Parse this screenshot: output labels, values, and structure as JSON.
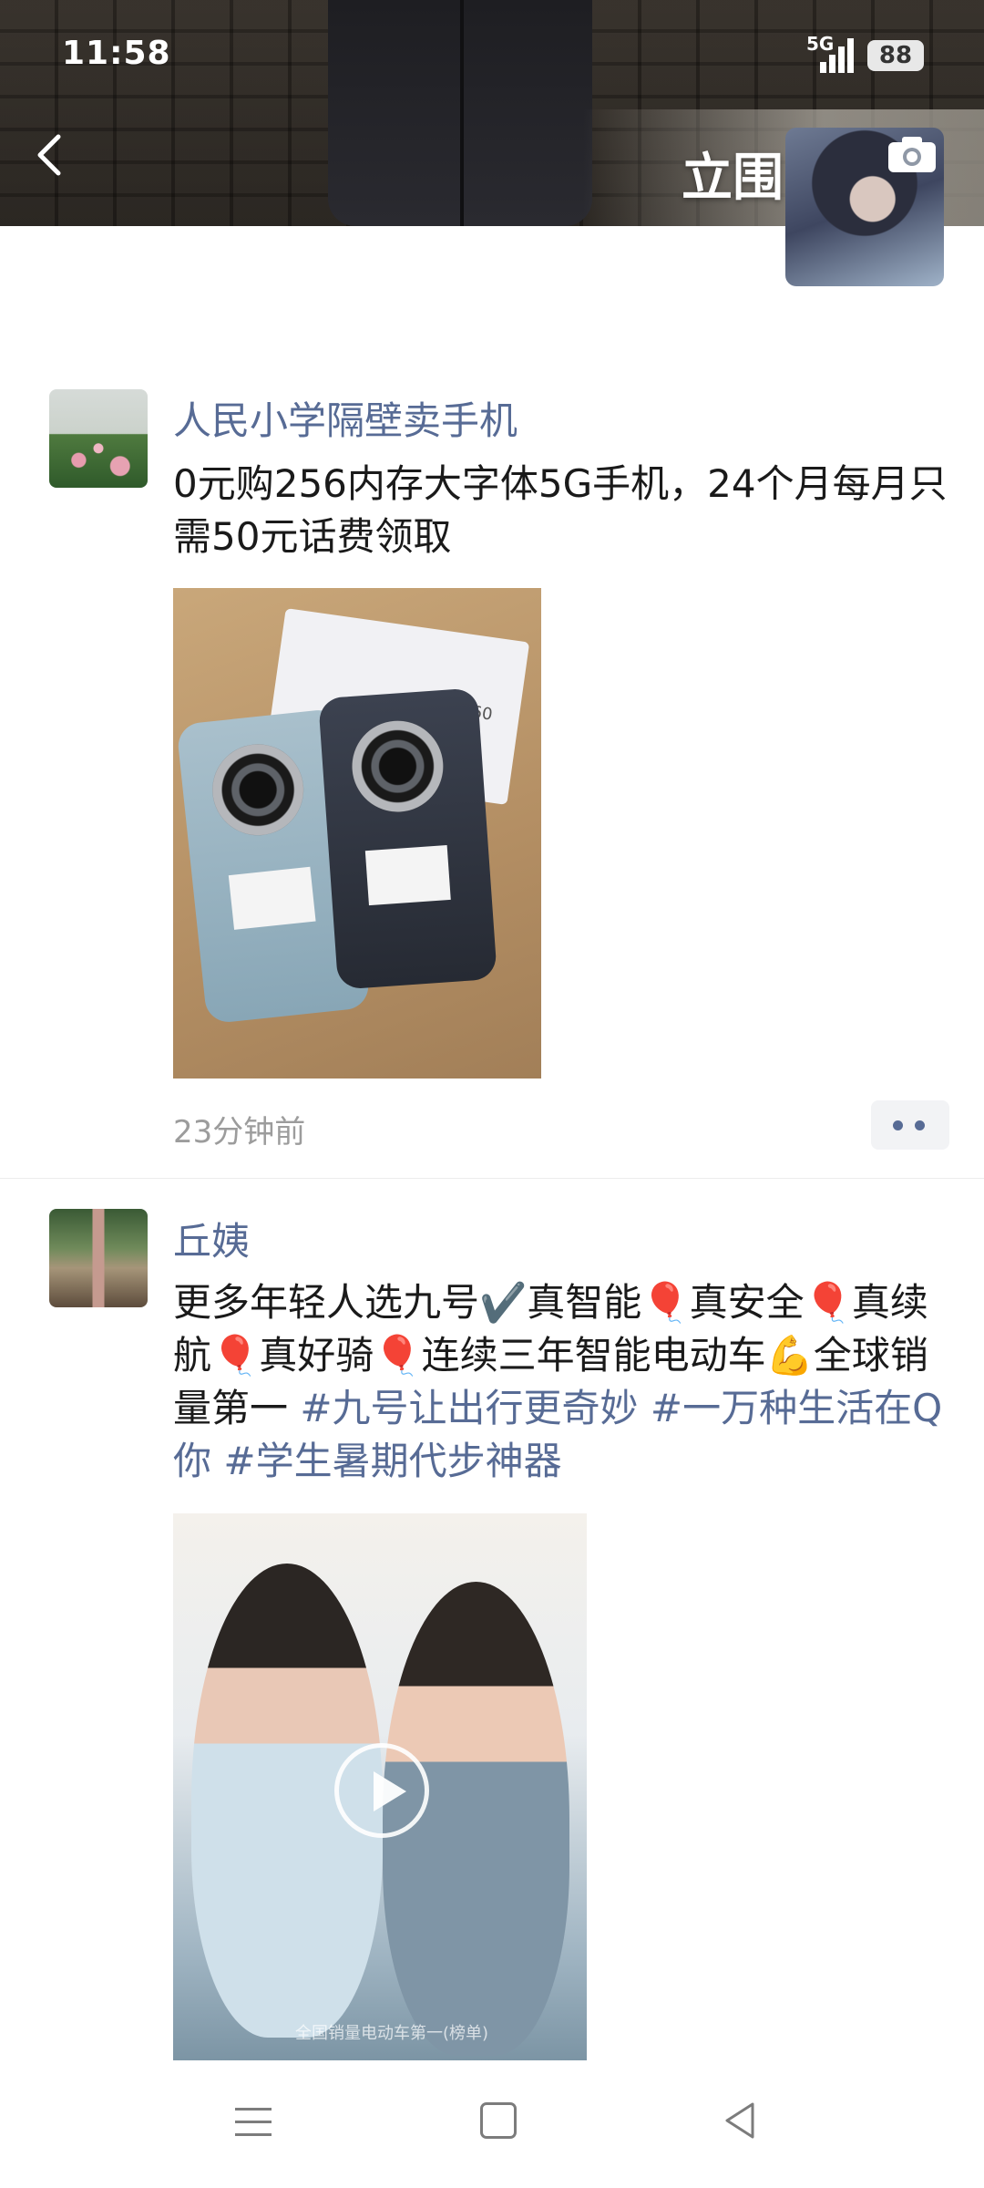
{
  "status_bar": {
    "time": "11:58",
    "network": "5G",
    "battery": "88"
  },
  "profile": {
    "name": "立围",
    "back_icon": "chevron-left-icon",
    "camera_icon": "camera-icon"
  },
  "posts": [
    {
      "nickname": "人民小学隔壁卖手机",
      "text": "0元购256内存大字体5G手机，24个月每月只需50元话费领取",
      "image_box_label": "中兴远航 60 Plus",
      "time": "23分钟前"
    },
    {
      "nickname": "丘姨",
      "text_parts": {
        "body": "更多年轻人选九号✔️真智能🎈真安全🎈真续航🎈真好骑🎈连续三年智能电动车💪全球销量第一 ",
        "tag1": "#九号让出行更奇妙",
        "tag2": "#一万种生活在Q你",
        "tag3": "#学生暑期代步神器"
      },
      "video_caption": "全国销量电动车第一(榜单)"
    }
  ],
  "nav_bar": {
    "menu_icon": "menu-icon",
    "home_icon": "home-icon",
    "back_icon": "back-triangle-icon"
  }
}
